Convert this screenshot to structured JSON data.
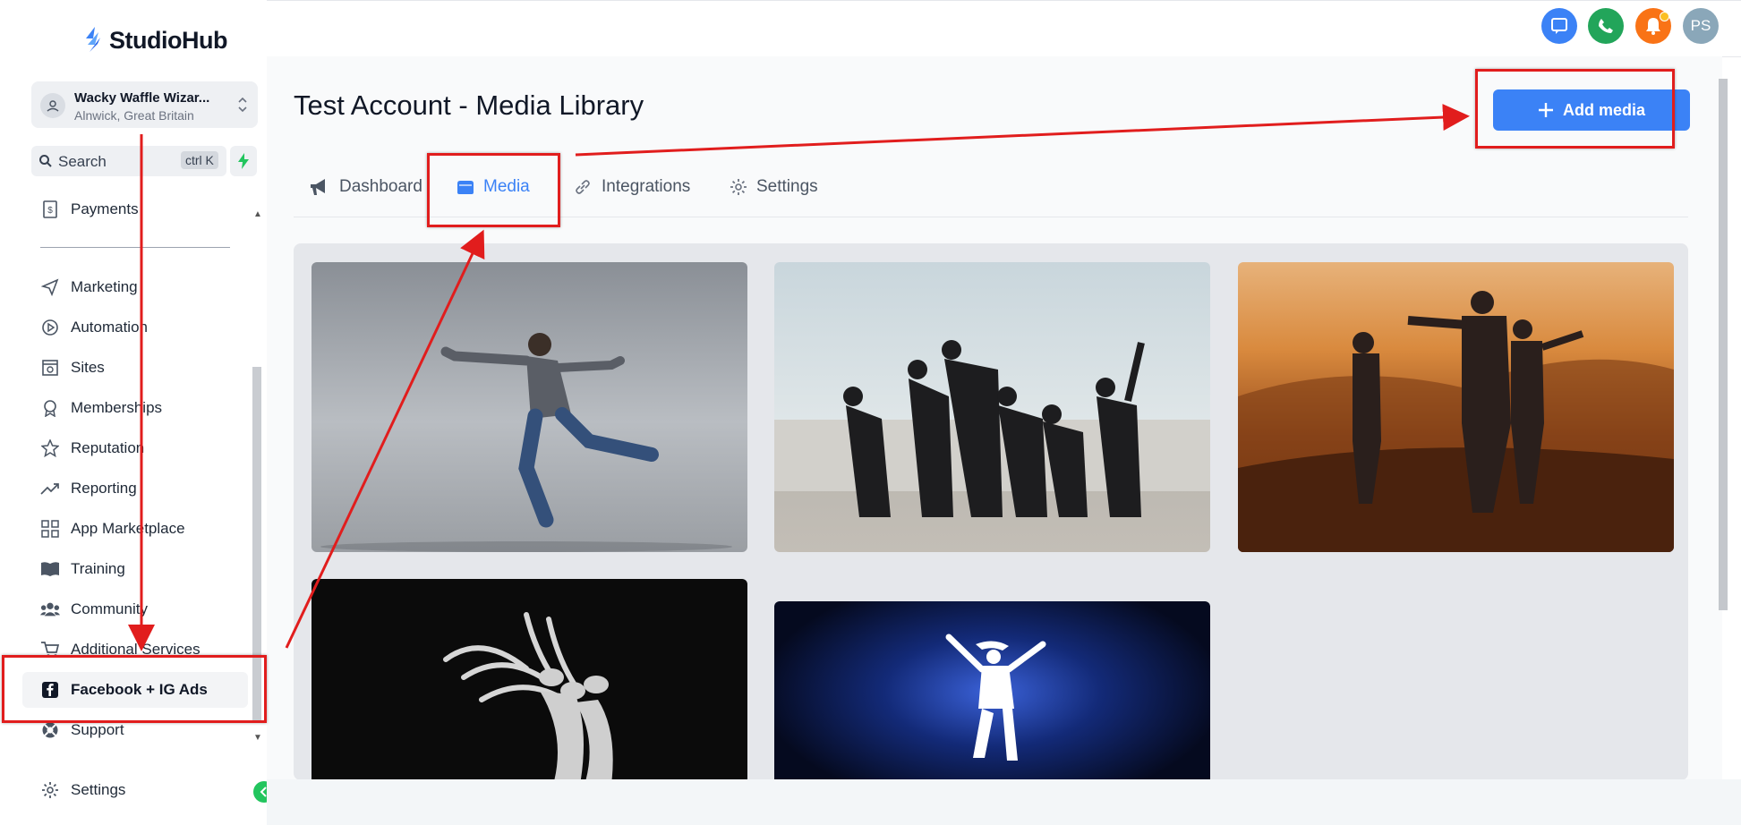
{
  "app": {
    "name": "StudioHub"
  },
  "account": {
    "name": "Wacky Waffle Wizar...",
    "location": "Alnwick, Great Britain"
  },
  "search": {
    "placeholder": "Search",
    "shortcut": "ctrl K"
  },
  "sidebar": {
    "items": [
      {
        "label": "Payments",
        "icon": "payments-icon"
      },
      {
        "label": "Marketing",
        "icon": "send-icon"
      },
      {
        "label": "Automation",
        "icon": "automation-icon"
      },
      {
        "label": "Sites",
        "icon": "sites-icon"
      },
      {
        "label": "Memberships",
        "icon": "badge-icon"
      },
      {
        "label": "Reputation",
        "icon": "star-icon"
      },
      {
        "label": "Reporting",
        "icon": "trend-icon"
      },
      {
        "label": "App Marketplace",
        "icon": "grid-icon"
      },
      {
        "label": "Training",
        "icon": "book-icon"
      },
      {
        "label": "Community",
        "icon": "people-icon"
      },
      {
        "label": "Additional Services",
        "icon": "cart-icon"
      },
      {
        "label": "Facebook + IG Ads",
        "icon": "facebook-icon",
        "active": true
      },
      {
        "label": "Support",
        "icon": "lifebuoy-icon"
      },
      {
        "label": "Settings",
        "icon": "gear-icon"
      }
    ]
  },
  "topbar": {
    "icons": [
      "chat-icon",
      "phone-icon",
      "bell-icon"
    ],
    "user_initials": "PS"
  },
  "page": {
    "title": "Test Account - Media Library",
    "add_button": "Add media"
  },
  "tabs": [
    {
      "label": "Dashboard",
      "icon": "megaphone-icon"
    },
    {
      "label": "Media",
      "icon": "folder-icon",
      "active": true
    },
    {
      "label": "Integrations",
      "icon": "link-icon"
    },
    {
      "label": "Settings",
      "icon": "gear-icon"
    }
  ],
  "colors": {
    "accent": "#3b82f6",
    "annotation": "#e11d1d",
    "active_text": "#111827"
  }
}
